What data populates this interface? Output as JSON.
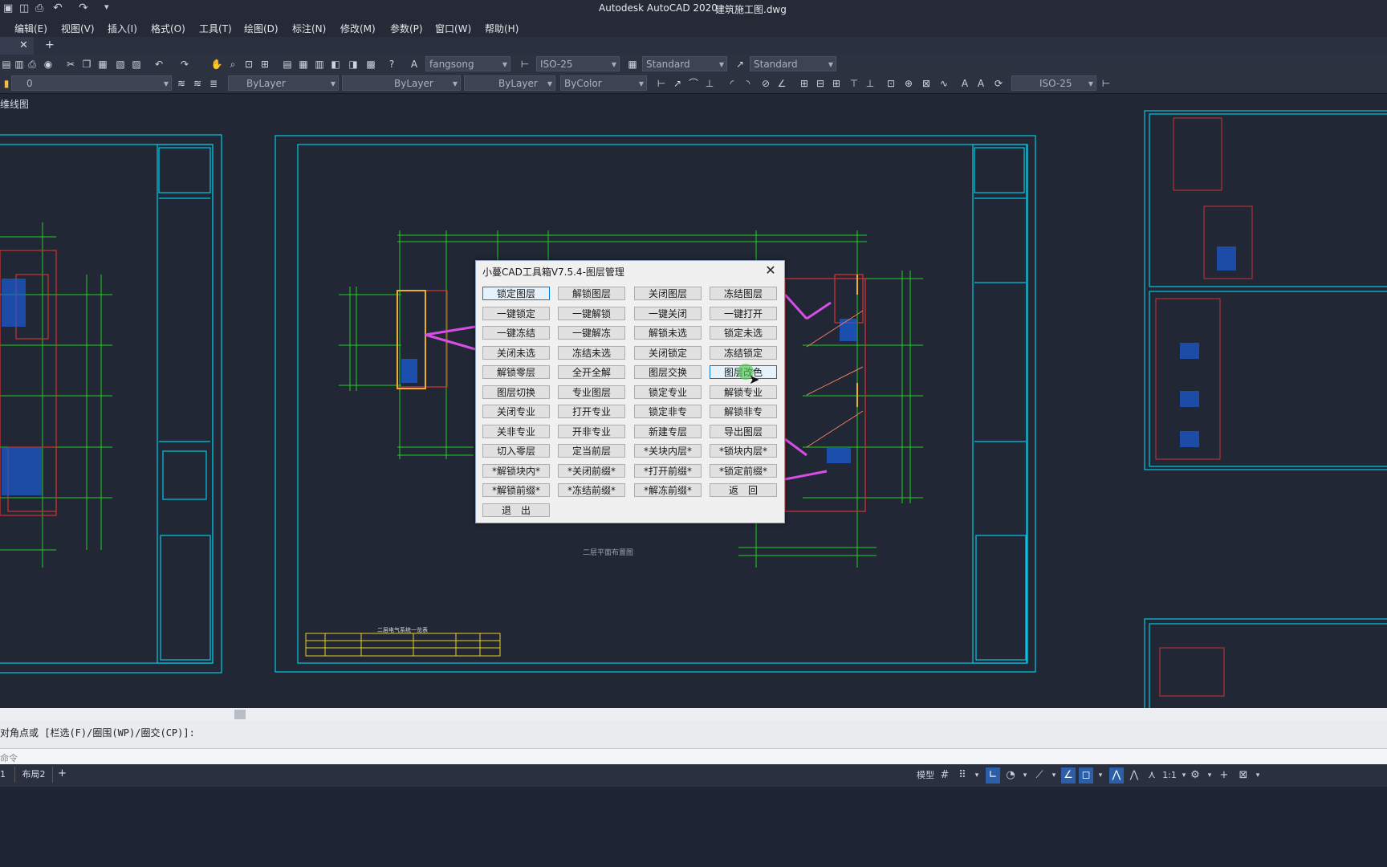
{
  "app": {
    "title": "Autodesk AutoCAD 2020",
    "document": "建筑施工图.dwg"
  },
  "menu": [
    "编辑(E)",
    "视图(V)",
    "插入(I)",
    "格式(O)",
    "工具(T)",
    "绘图(D)",
    "标注(N)",
    "修改(M)",
    "参数(P)",
    "窗口(W)",
    "帮助(H)"
  ],
  "toolbar": {
    "text_style": "fangsong",
    "dim_style": "ISO-25",
    "table_style": "Standard",
    "mleader_style": "Standard",
    "layer": "0",
    "color": "ByLayer",
    "linetype": "ByLayer",
    "lineweight": "ByLayer",
    "plotstyle": "ByColor",
    "dim_style2": "ISO-25"
  },
  "viewport": {
    "label": "维线图",
    "drawing_title_center": "二层平面布置图",
    "table_title": "二层电气系统一览表"
  },
  "dialog": {
    "title": "小蔓CAD工具箱V7.5.4-图层管理",
    "close_glyph": "✕",
    "buttons": [
      "锁定图层",
      "解锁图层",
      "关闭图层",
      "冻结图层",
      "一键锁定",
      "一键解锁",
      "一键关闭",
      "一键打开",
      "一键冻结",
      "一键解冻",
      "解锁未选",
      "锁定未选",
      "关闭未选",
      "冻结未选",
      "关闭锁定",
      "冻结锁定",
      "解锁零层",
      "全开全解",
      "图层交换",
      "图层改色",
      "图层切换",
      "专业图层",
      "锁定专业",
      "解锁专业",
      "关闭专业",
      "打开专业",
      "锁定非专",
      "解锁非专",
      "关非专业",
      "开非专业",
      "新建专层",
      "导出图层",
      "切入零层",
      "定当前层",
      "*关块内层*",
      "*锁块内层*",
      "*解锁块内*",
      "*关闭前缀*",
      "*打开前缀*",
      "*锁定前缀*",
      "*解锁前缀*",
      "*冻结前缀*",
      "*解冻前缀*",
      "返　回",
      "退　出"
    ],
    "selected_index": 0,
    "hover_index": 19
  },
  "command": {
    "history": "对角点或 [栏选(F)/圈围(WP)/圈交(CP)]:",
    "prompt": "命令"
  },
  "status": {
    "model_label": "模型",
    "scale": "1:1",
    "layout_tab": "布局2",
    "layout_tab_prev": "1",
    "add_tab": "+"
  },
  "colors": {
    "background": "#212734",
    "frame": "#00c8e6",
    "grid": "#1fd21f",
    "magenta": "#d64ee6",
    "dialog_bg": "#f0f0f0"
  }
}
